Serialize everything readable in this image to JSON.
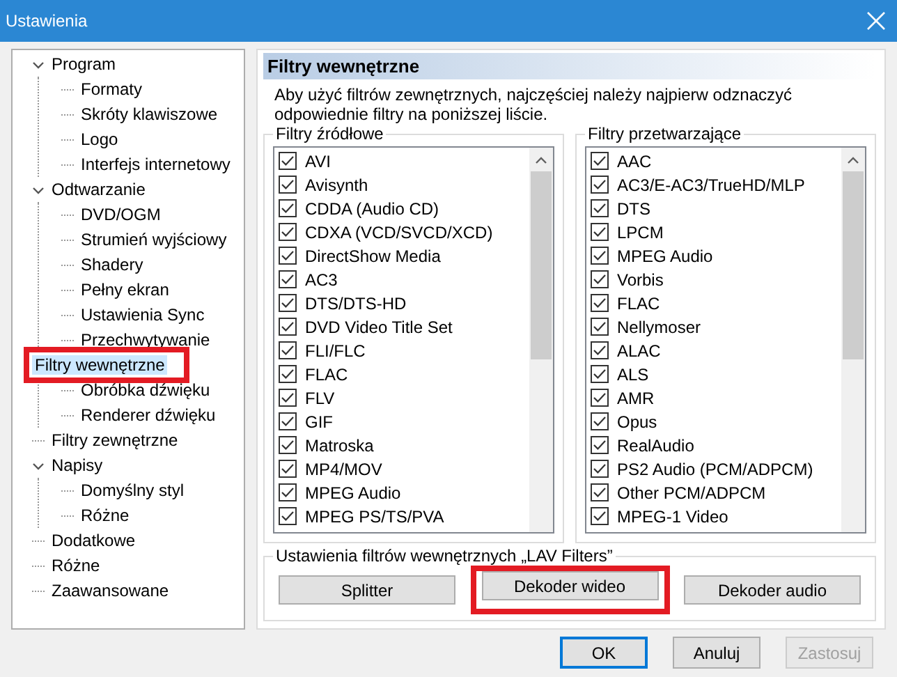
{
  "window": {
    "title": "Ustawienia"
  },
  "tree": [
    {
      "label": "Program",
      "expanded": true,
      "selected": false,
      "highlighted": false,
      "children": [
        {
          "label": "Formaty",
          "selected": false,
          "highlighted": false
        },
        {
          "label": "Skróty klawiszowe",
          "selected": false,
          "highlighted": false
        },
        {
          "label": "Logo",
          "selected": false,
          "highlighted": false
        },
        {
          "label": "Interfejs internetowy",
          "selected": false,
          "highlighted": false
        }
      ]
    },
    {
      "label": "Odtwarzanie",
      "expanded": true,
      "selected": false,
      "highlighted": false,
      "children": [
        {
          "label": "DVD/OGM",
          "selected": false,
          "highlighted": false
        },
        {
          "label": "Strumień wyjściowy",
          "selected": false,
          "highlighted": false
        },
        {
          "label": "Shadery",
          "selected": false,
          "highlighted": false
        },
        {
          "label": "Pełny ekran",
          "selected": false,
          "highlighted": false
        },
        {
          "label": "Ustawienia Sync",
          "selected": false,
          "highlighted": false
        },
        {
          "label": "Przechwytywanie",
          "selected": false,
          "highlighted": false
        }
      ]
    },
    {
      "label": "Filtry wewnętrzne",
      "expanded": true,
      "selected": true,
      "highlighted": true,
      "children": [
        {
          "label": "Obróbka dźwięku",
          "selected": false,
          "highlighted": false
        },
        {
          "label": "Renderer dźwięku",
          "selected": false,
          "highlighted": false
        }
      ]
    },
    {
      "label": "Filtry zewnętrzne",
      "selected": false,
      "highlighted": false
    },
    {
      "label": "Napisy",
      "expanded": true,
      "selected": false,
      "highlighted": false,
      "children": [
        {
          "label": "Domyślny styl",
          "selected": false,
          "highlighted": false
        },
        {
          "label": "Różne",
          "selected": false,
          "highlighted": false
        }
      ]
    },
    {
      "label": "Dodatkowe",
      "selected": false,
      "highlighted": false
    },
    {
      "label": "Różne",
      "selected": false,
      "highlighted": false
    },
    {
      "label": "Zaawansowane",
      "selected": false,
      "highlighted": false
    }
  ],
  "panel": {
    "title": "Filtry wewnętrzne",
    "description": "Aby użyć filtrów zewnętrznych, najczęściej należy najpierw odznaczyć odpowiednie filtry na poniższej liście.",
    "groups": [
      {
        "label": "Filtry źródłowe",
        "items": [
          {
            "label": "AVI",
            "checked": true
          },
          {
            "label": "Avisynth",
            "checked": true
          },
          {
            "label": "CDDA (Audio CD)",
            "checked": true
          },
          {
            "label": "CDXA (VCD/SVCD/XCD)",
            "checked": true
          },
          {
            "label": "DirectShow Media",
            "checked": true
          },
          {
            "label": "AC3",
            "checked": true
          },
          {
            "label": "DTS/DTS-HD",
            "checked": true
          },
          {
            "label": "DVD Video Title Set",
            "checked": true
          },
          {
            "label": "FLI/FLC",
            "checked": true
          },
          {
            "label": "FLAC",
            "checked": true
          },
          {
            "label": "FLV",
            "checked": true
          },
          {
            "label": "GIF",
            "checked": true
          },
          {
            "label": "Matroska",
            "checked": true
          },
          {
            "label": "MP4/MOV",
            "checked": true
          },
          {
            "label": "MPEG Audio",
            "checked": true
          },
          {
            "label": "MPEG PS/TS/PVA",
            "checked": true
          }
        ]
      },
      {
        "label": "Filtry przetwarzające",
        "items": [
          {
            "label": "AAC",
            "checked": true
          },
          {
            "label": "AC3/E-AC3/TrueHD/MLP",
            "checked": true
          },
          {
            "label": "DTS",
            "checked": true
          },
          {
            "label": "LPCM",
            "checked": true
          },
          {
            "label": "MPEG Audio",
            "checked": true
          },
          {
            "label": "Vorbis",
            "checked": true
          },
          {
            "label": "FLAC",
            "checked": true
          },
          {
            "label": "Nellymoser",
            "checked": true
          },
          {
            "label": "ALAC",
            "checked": true
          },
          {
            "label": "ALS",
            "checked": true
          },
          {
            "label": "AMR",
            "checked": true
          },
          {
            "label": "Opus",
            "checked": true
          },
          {
            "label": "RealAudio",
            "checked": true
          },
          {
            "label": "PS2 Audio (PCM/ADPCM)",
            "checked": true
          },
          {
            "label": "Other PCM/ADPCM",
            "checked": true
          },
          {
            "label": "MPEG-1 Video",
            "checked": true
          }
        ]
      }
    ],
    "settings": {
      "label": "Ustawienia filtrów wewnętrznych „LAV Filters”",
      "buttons": [
        {
          "label": "Splitter",
          "highlighted": false
        },
        {
          "label": "Dekoder wideo",
          "highlighted": true
        },
        {
          "label": "Dekoder audio",
          "highlighted": false
        }
      ]
    }
  },
  "footer": [
    {
      "label": "OK",
      "default": true,
      "disabled": false
    },
    {
      "label": "Anuluj",
      "default": false,
      "disabled": false
    },
    {
      "label": "Zastosuj",
      "default": false,
      "disabled": true
    }
  ]
}
